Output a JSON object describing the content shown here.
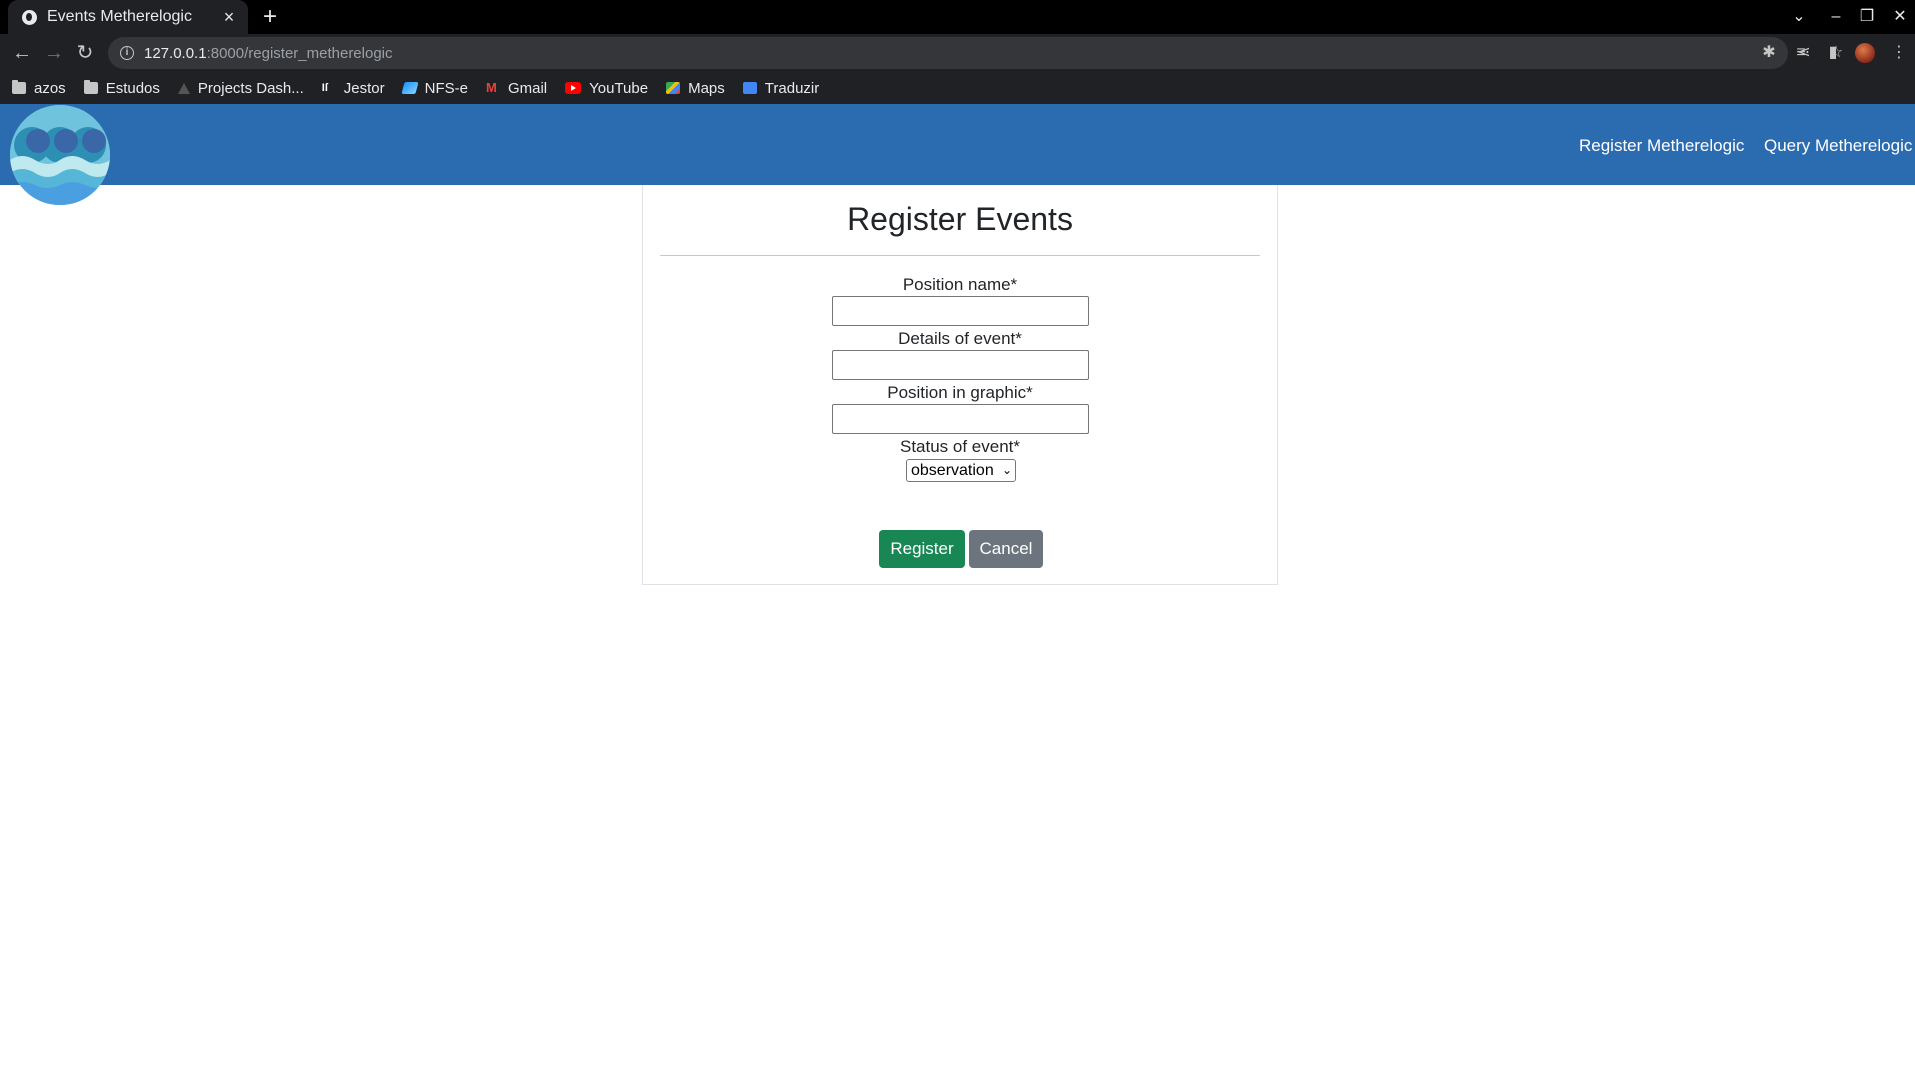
{
  "browser": {
    "tab_title": "Events Metherelogic",
    "url_host": "127.0.0.1",
    "url_path": ":8000/register_metherelogic",
    "bookmarks": [
      {
        "label": "azos",
        "icon": "folder-icon"
      },
      {
        "label": "Estudos",
        "icon": "folder-icon"
      },
      {
        "label": "Projects Dash...",
        "icon": "dashboard-icon"
      },
      {
        "label": "Jestor",
        "icon": "jestor-icon"
      },
      {
        "label": "NFS-e",
        "icon": "nfse-icon"
      },
      {
        "label": "Gmail",
        "icon": "gmail-icon"
      },
      {
        "label": "YouTube",
        "icon": "youtube-icon"
      },
      {
        "label": "Maps",
        "icon": "maps-icon"
      },
      {
        "label": "Traduzir",
        "icon": "translate-icon"
      }
    ]
  },
  "navbar": {
    "links": [
      {
        "label": "Register Metherelogic"
      },
      {
        "label": "Query Metherelogic"
      }
    ]
  },
  "form": {
    "title": "Register Events",
    "fields": [
      {
        "label": "Position name*",
        "value": ""
      },
      {
        "label": "Details of event*",
        "value": ""
      },
      {
        "label": "Position in graphic*",
        "value": ""
      }
    ],
    "status": {
      "label": "Status of event*",
      "selected": "observation"
    },
    "register_label": "Register",
    "cancel_label": "Cancel"
  },
  "colors": {
    "navbar": "#2b6cb0",
    "register_button": "#198754",
    "cancel_button": "#6c757d"
  }
}
